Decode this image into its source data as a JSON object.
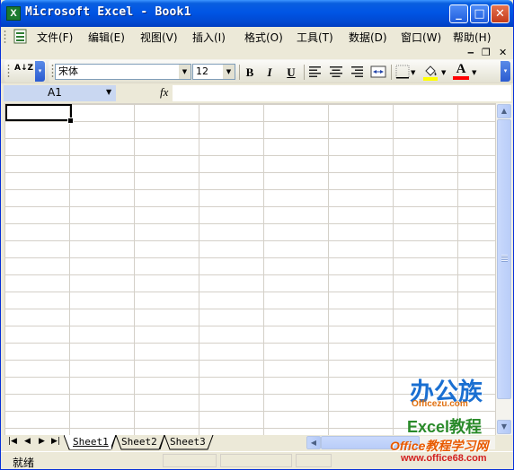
{
  "window": {
    "title": "Microsoft Excel - Book1",
    "app_icon_letter": "X",
    "controls": {
      "minimize": "_",
      "maximize": "□",
      "close": "✕"
    }
  },
  "menubar": {
    "items": [
      {
        "label": "文件(F)"
      },
      {
        "label": "编辑(E)"
      },
      {
        "label": "视图(V)"
      },
      {
        "label": "插入(I)"
      },
      {
        "label": "格式(O)"
      },
      {
        "label": "工具(T)"
      },
      {
        "label": "数据(D)"
      },
      {
        "label": "窗口(W)"
      },
      {
        "label": "帮助(H)"
      }
    ],
    "doc_controls": {
      "minimize": "‒",
      "restore": "❐",
      "close": "✕"
    }
  },
  "toolbar": {
    "sort_label": "A↓Z",
    "font_name": "宋体",
    "font_size": "12",
    "bold": "B",
    "italic": "I",
    "underline": "U",
    "font_color_letter": "A",
    "fill_color": "#ffff00",
    "font_color": "#ff0000"
  },
  "formula_bar": {
    "name_box_value": "A1",
    "fx_label": "fx"
  },
  "sheets": {
    "nav": [
      "|◀",
      "◀",
      "▶",
      "▶|"
    ],
    "tabs": [
      "Sheet1",
      "Sheet2",
      "Sheet3"
    ],
    "active": "Sheet1"
  },
  "status": {
    "text": "就绪"
  },
  "watermark": {
    "logo_text": "办公族",
    "site_name": "Officezu.com",
    "tagline": "Excel教程",
    "footer_brand": "Office教程学习网",
    "footer_url": "www.office68.com"
  }
}
